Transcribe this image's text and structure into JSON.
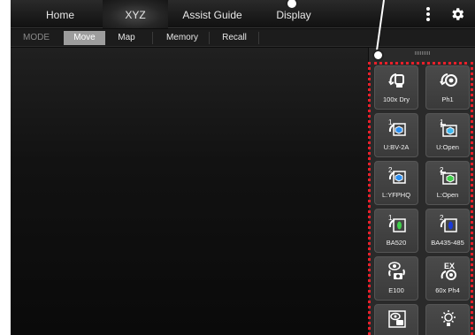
{
  "topnav": {
    "tabs": [
      {
        "label": "Home"
      },
      {
        "label": "XYZ"
      },
      {
        "label": "Assist Guide"
      },
      {
        "label": "Display"
      }
    ],
    "active_tab": "XYZ",
    "menu_icon": "kebab-menu-icon",
    "settings_icon": "gear-icon"
  },
  "subnav": {
    "mode_label": "MODE",
    "items": [
      {
        "label": "Move"
      },
      {
        "label": "Map"
      },
      {
        "label": "Memory"
      },
      {
        "label": "Recall"
      }
    ],
    "active_item": "Move"
  },
  "panel": {
    "buttons": [
      {
        "label": "100x Dry",
        "icon": "objective-dry-icon"
      },
      {
        "label": "Ph1",
        "icon": "objective-phase-icon"
      },
      {
        "label": "U:BV-2A",
        "icon": "upper-turret-cube-icon"
      },
      {
        "label": "U:Open",
        "icon": "upper-turret-open-icon"
      },
      {
        "label": "L:YFPHQ",
        "icon": "lower-turret-cube-icon"
      },
      {
        "label": "L:Open",
        "icon": "lower-turret-open-icon"
      },
      {
        "label": "BA520",
        "icon": "filter-green-icon"
      },
      {
        "label": "BA435-485",
        "icon": "filter-blue-icon"
      },
      {
        "label": "E100",
        "icon": "eyepiece-camera-icon"
      },
      {
        "label": "60x Ph4",
        "icon": "ex-objective-icon"
      },
      {
        "label": "",
        "icon": "eye-camera-icon"
      },
      {
        "label": "",
        "icon": "lamp-icon"
      }
    ]
  },
  "colors": {
    "highlight": "#e8202a",
    "background": "#0d0d0d",
    "active_subitem": "#9d9d9d"
  }
}
